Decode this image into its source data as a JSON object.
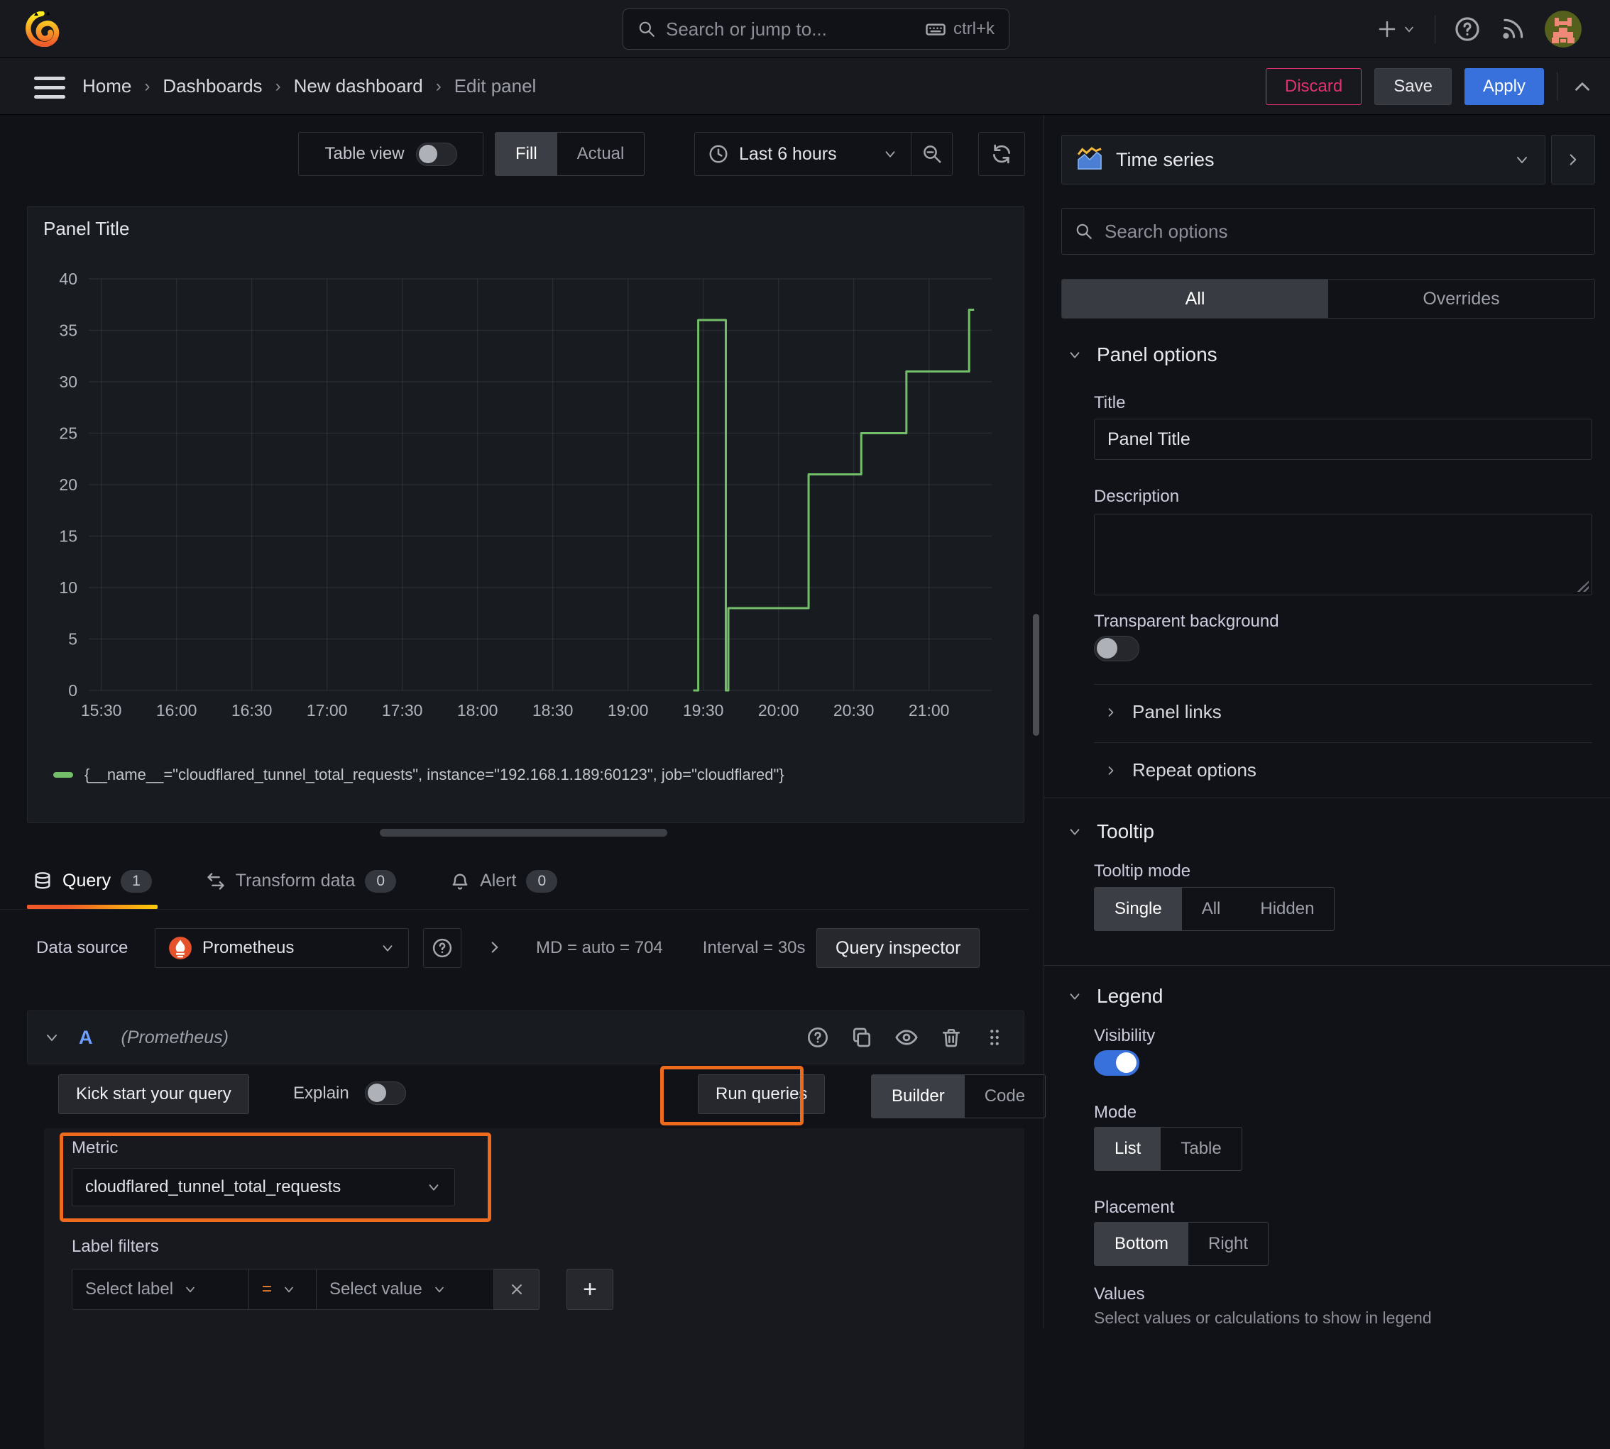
{
  "topbar": {
    "search_placeholder": "Search or jump to...",
    "shortcut": "ctrl+k"
  },
  "breadcrumb": {
    "items": [
      "Home",
      "Dashboards",
      "New dashboard",
      "Edit panel"
    ],
    "discard": "Discard",
    "save": "Save",
    "apply": "Apply"
  },
  "panel_toolbar": {
    "table_view": "Table view",
    "fill": "Fill",
    "actual": "Actual",
    "time_range": "Last 6 hours"
  },
  "panel": {
    "title": "Panel Title"
  },
  "chart_data": {
    "type": "line",
    "title": "Panel Title",
    "step": true,
    "grid": true,
    "legend_position": "bottom",
    "x_range": [
      "15:25",
      "21:25"
    ],
    "x_ticks": [
      "15:30",
      "16:00",
      "16:30",
      "17:00",
      "17:30",
      "18:00",
      "18:30",
      "19:00",
      "19:30",
      "20:00",
      "20:30",
      "21:00"
    ],
    "y_ticks": [
      0,
      5,
      10,
      15,
      20,
      25,
      30,
      35,
      40
    ],
    "ylim": [
      0,
      40
    ],
    "series": [
      {
        "name": "{__name__=\"cloudflared_tunnel_total_requests\", instance=\"192.168.1.189:60123\", job=\"cloudflared\"}",
        "color": "#73bf69",
        "points": [
          [
            "19:26",
            0
          ],
          [
            "19:28",
            0
          ],
          [
            "19:28",
            36
          ],
          [
            "19:39",
            36
          ],
          [
            "19:39",
            0
          ],
          [
            "19:40",
            0
          ],
          [
            "19:40",
            8
          ],
          [
            "20:12",
            8
          ],
          [
            "20:12",
            21
          ],
          [
            "20:33",
            21
          ],
          [
            "20:33",
            25
          ],
          [
            "20:51",
            25
          ],
          [
            "20:51",
            31
          ],
          [
            "21:16",
            31
          ],
          [
            "21:16",
            37
          ],
          [
            "21:18",
            37
          ]
        ]
      }
    ]
  },
  "tabs": [
    {
      "label": "Query",
      "count": "1"
    },
    {
      "label": "Transform data",
      "count": "0"
    },
    {
      "label": "Alert",
      "count": "0"
    }
  ],
  "datasource_row": {
    "label": "Data source",
    "value": "Prometheus",
    "md": "MD = auto = 704",
    "interval": "Interval = 30s",
    "query_inspector": "Query inspector"
  },
  "query_editor": {
    "ref_id": "A",
    "datasource_hint": "(Prometheus)",
    "kick_start": "Kick start your query",
    "explain": "Explain",
    "run_queries": "Run queries",
    "builder": "Builder",
    "code": "Code",
    "metric_label": "Metric",
    "metric_value": "cloudflared_tunnel_total_requests",
    "label_filters_label": "Label filters",
    "select_label_placeholder": "Select label",
    "operator": "=",
    "select_value_placeholder": "Select value"
  },
  "options_pane": {
    "visualization": "Time series",
    "search_placeholder": "Search options",
    "tabs": {
      "all": "All",
      "overrides": "Overrides"
    },
    "panel_options": {
      "heading": "Panel options",
      "title_label": "Title",
      "title_value": "Panel Title",
      "description_label": "Description",
      "transparent_label": "Transparent background"
    },
    "collapsed_sections": [
      "Panel links",
      "Repeat options"
    ],
    "tooltip": {
      "heading": "Tooltip",
      "mode_label": "Tooltip mode",
      "options": [
        "Single",
        "All",
        "Hidden"
      ],
      "selected": "Single"
    },
    "legend": {
      "heading": "Legend",
      "visibility_label": "Visibility",
      "mode_label": "Mode",
      "mode_options": [
        "List",
        "Table"
      ],
      "mode_selected": "List",
      "placement_label": "Placement",
      "placement_options": [
        "Bottom",
        "Right"
      ],
      "placement_selected": "Bottom",
      "values_label": "Values",
      "values_hint": "Select values or calculations to show in legend"
    }
  },
  "colors": {
    "series_green": "#73bf69",
    "accent_orange": "#ee6a1c",
    "apply_blue": "#3871dc",
    "discard_pink": "#e0316e",
    "tab_underline": "orange-yellow-gradient"
  }
}
